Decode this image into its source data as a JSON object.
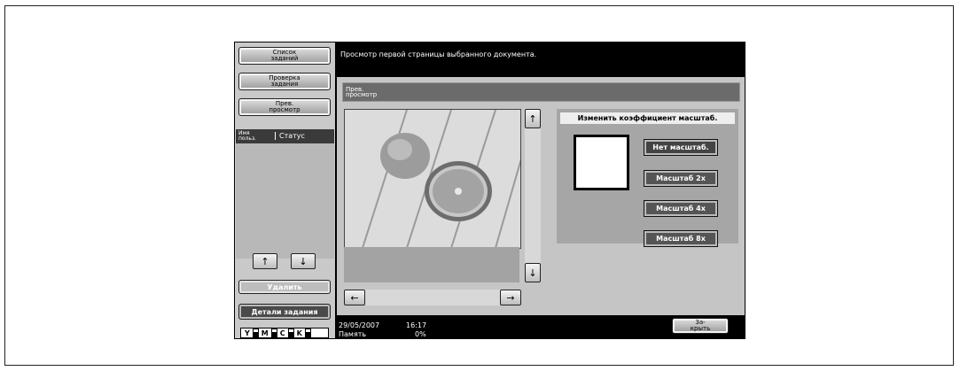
{
  "left_menu": {
    "job_list": "Список\nзаданий",
    "job_check": "Проверка\nзадания",
    "preview": "Прев.\nпросмотр",
    "user_name_header": "Имя\nпольз.",
    "status_header": "Статус",
    "delete": "Удалить",
    "job_details": "Детали задания"
  },
  "message": "Просмотр первой страницы выбранного документа.",
  "title": "Прев.\nпросмотр",
  "zoom": {
    "title": "Изменить коэффициент масштаб.",
    "options": [
      "Нет масштаб.",
      "Масштаб 2x",
      "Масштаб 4x",
      "Масштаб 8x"
    ]
  },
  "close": "За-\nкрыть",
  "status": {
    "date": "29/05/2007",
    "time": "16:17",
    "memory_label": "Память",
    "memory_value": "0%"
  },
  "toner": [
    "Y",
    "M",
    "C",
    "K"
  ]
}
